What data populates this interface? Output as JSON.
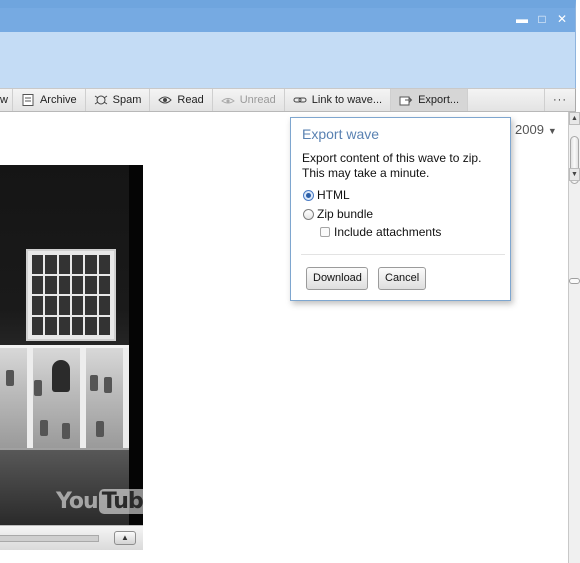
{
  "window": {
    "minimize_glyph": "▬",
    "maximize_glyph": "□",
    "close_glyph": "✕"
  },
  "toolbar": {
    "items": [
      {
        "label": "w",
        "icon": "partial-icon"
      },
      {
        "label": "Archive",
        "icon": "archive-icon"
      },
      {
        "label": "Spam",
        "icon": "spam-icon"
      },
      {
        "label": "Read",
        "icon": "eye-icon"
      },
      {
        "label": "Unread",
        "icon": "unread-icon"
      },
      {
        "label": "Link to wave...",
        "icon": "link-icon"
      },
      {
        "label": "Export...",
        "icon": "export-icon"
      }
    ],
    "more_label": "···"
  },
  "content": {
    "year_label": "2009",
    "year_caret": "▼"
  },
  "video": {
    "logo_you": "You",
    "logo_tube": "Tube",
    "expand_glyph": "▲"
  },
  "scrollbar": {
    "up_glyph": "▲",
    "down_glyph": "▼"
  },
  "export_dialog": {
    "title": "Export wave",
    "description": "Export content of this wave to zip. This may take a minute.",
    "options": {
      "html_label": "HTML",
      "zip_label": "Zip bundle",
      "attachments_label": "Include attachments"
    },
    "selected_format": "HTML",
    "include_attachments": false,
    "download_label": "Download",
    "cancel_label": "Cancel"
  },
  "colors": {
    "titlebar": "#c4dcf5",
    "titlebar_accent": "#76aae2",
    "dialog_title": "#5a82b2",
    "dialog_border": "#7ea6cf"
  }
}
